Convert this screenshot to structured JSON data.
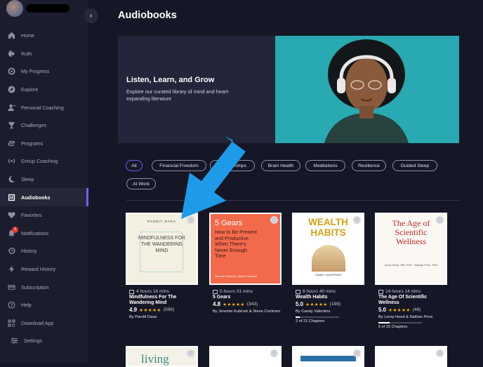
{
  "sidebar": {
    "items": [
      {
        "label": "Home",
        "icon": "home-icon"
      },
      {
        "label": "Ruth",
        "icon": "ruth-icon"
      },
      {
        "label": "My Progress",
        "icon": "progress-icon"
      },
      {
        "label": "Explore",
        "icon": "compass-icon"
      },
      {
        "label": "Personal Coaching",
        "icon": "coach-icon"
      },
      {
        "label": "Challenges",
        "icon": "trophy-icon"
      },
      {
        "label": "Programs",
        "icon": "programs-icon"
      },
      {
        "label": "Group Coaching",
        "icon": "broadcast-icon"
      },
      {
        "label": "Sleep",
        "icon": "moon-icon"
      },
      {
        "label": "Audiobooks",
        "icon": "audiobook-icon",
        "active": true
      },
      {
        "label": "Favorites",
        "icon": "heart-icon"
      },
      {
        "label": "Notifications",
        "icon": "bell-icon",
        "badge": "1"
      },
      {
        "label": "History",
        "icon": "history-icon"
      },
      {
        "label": "Reward History",
        "icon": "bolt-icon"
      },
      {
        "label": "Subscription",
        "icon": "card-icon"
      },
      {
        "label": "Help",
        "icon": "help-icon"
      },
      {
        "label": "Download App",
        "icon": "qr-icon"
      },
      {
        "label": "Settings",
        "icon": "sliders-icon"
      }
    ]
  },
  "main": {
    "title": "Audiobooks",
    "hero": {
      "title": "Listen, Learn, and Grow",
      "subtitle": "Explore our curated library of mind and heart-expanding literature"
    },
    "filters": [
      "All",
      "Financial Freedom",
      "Relationships",
      "Brain Health",
      "Meditations",
      "Resilience",
      "Guided Sleep",
      "At Work"
    ],
    "books": [
      {
        "cover_title": "MINDFULNESS FOR THE WANDERING MIND",
        "cover_author": "PANDIT DASA",
        "duration": "4 hours 16 mins",
        "title": "Mindfulness For The Wandering Mind",
        "rating": "4.9",
        "stars": "★★★★★",
        "count": "(596)",
        "author": "By Pandit Dasa"
      },
      {
        "cover_title": "5 Gears",
        "cover_subtitle": "How to Be Present and Productive When There's Never Enough Time",
        "cover_author": "Jeremie Kubicek | Steve Cockram",
        "duration": "5 hours 31 mins",
        "title": "5 Gears",
        "rating": "4.8",
        "stars": "★★★★★",
        "count": "(343)",
        "author": "By Jeremie Kubicek & Steve Cockram"
      },
      {
        "cover_title": "WEALTH HABITS",
        "cover_author": "CANDY VALENTINO",
        "duration": "8 hours 40 mins",
        "title": "Wealth Habits",
        "rating": "5.0",
        "stars": "★★★★★",
        "count": "(199)",
        "author": "By Candy Valentino",
        "progress": 0.09,
        "chapters": "2 of 22 Chapters"
      },
      {
        "cover_title": "The Age of Scientific Wellness",
        "cover_author": "Leroy Hood, MD, PhD · Nathan Price, PhD",
        "duration": "14 hours 14 mins",
        "title": "The Age Of Scientific Wellness",
        "rating": "5.0",
        "stars": "★★★★★",
        "count": "(46)",
        "author": "By Leroy Hood & Nathan Price",
        "progress": 0.25,
        "chapters": "5 of 20 Chapters"
      }
    ],
    "second_row": [
      {
        "cover_title": "living"
      },
      {
        "cover_title": ""
      },
      {
        "cover_title": ""
      },
      {
        "cover_title": ""
      }
    ]
  },
  "colors": {
    "accent": "#7b5cff",
    "background": "#151726",
    "sidebar": "#1b1d2d",
    "star": "#f5b400",
    "annotation_arrow": "#1e9be8"
  }
}
